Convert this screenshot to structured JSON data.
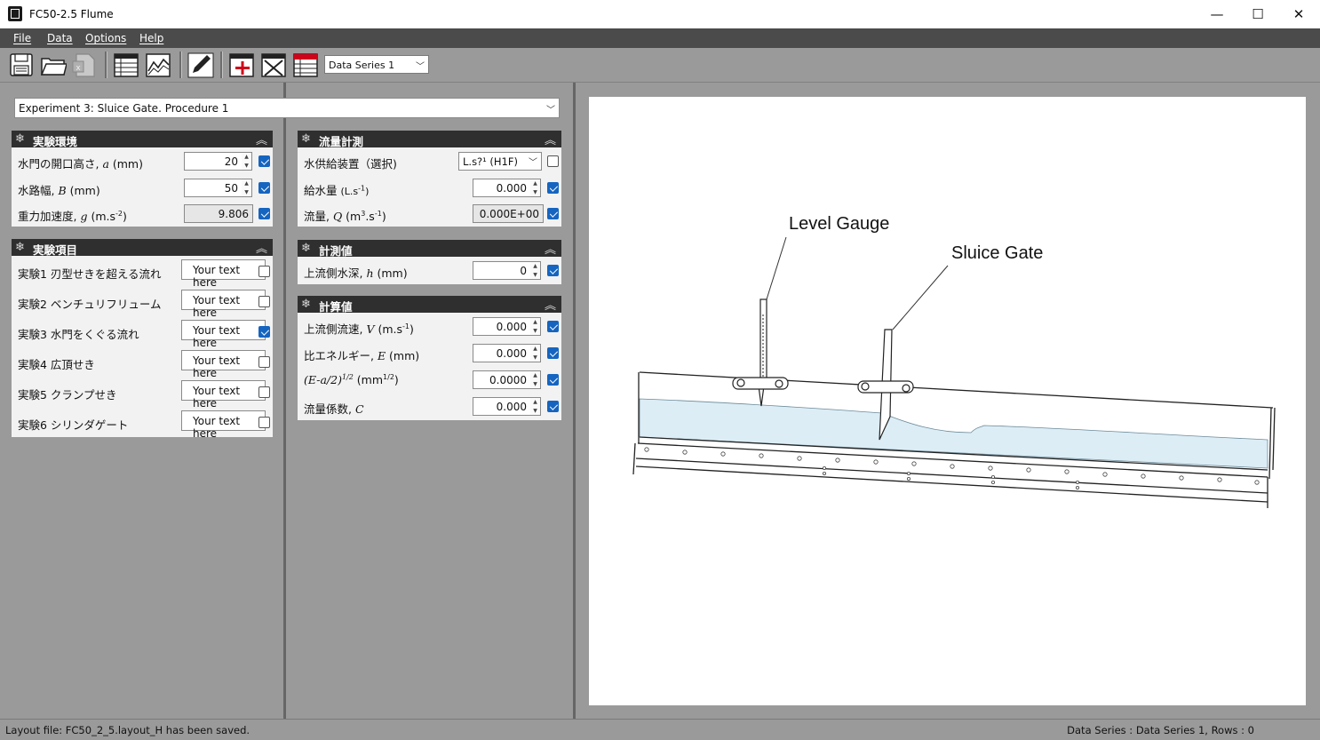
{
  "window": {
    "title": "FC50-2.5 Flume",
    "minimize": "—",
    "maximize": "☐",
    "close": "✕"
  },
  "menu": [
    "File",
    "Data",
    "Options",
    "Help"
  ],
  "toolbar": {
    "series_selected": "Data Series 1"
  },
  "experiment_select": "Experiment 3: Sluice Gate. Procedure 1",
  "env_panel": {
    "title": "実験環境",
    "rows": [
      {
        "label": "水門の開口高さ, ",
        "sym": "a",
        "unit": " (mm)",
        "value": "20",
        "checked": true
      },
      {
        "label": "水路幅, ",
        "sym": "B",
        "unit": " (mm)",
        "value": "50",
        "checked": true
      },
      {
        "label": "重力加速度, ",
        "sym": "g",
        "unit": " (m.s-2)",
        "value": "9.806",
        "checked": true
      }
    ]
  },
  "exp_panel": {
    "title": "実験項目",
    "placeholder": "Your text here",
    "rows": [
      {
        "label": "実験1 刃型せきを超える流れ",
        "checked": false
      },
      {
        "label": "実験2 ベンチュリフリューム",
        "checked": false
      },
      {
        "label": "実験3 水門をくぐる流れ",
        "checked": true
      },
      {
        "label": "実験4 広頂せき",
        "checked": false
      },
      {
        "label": "実験5 クランプせき",
        "checked": false
      },
      {
        "label": "実験6 シリンダゲート",
        "checked": false
      }
    ]
  },
  "flow_panel": {
    "title": "流量計測",
    "rows": [
      {
        "label": "水供給装置（選択)",
        "value": "L.s?¹ (H1F)",
        "checked": false
      },
      {
        "label": "給水量 ",
        "unit": "(L.s-1)",
        "value": "0.000",
        "checked": true
      },
      {
        "label": "流量, ",
        "sym": "Q",
        "unit": " (m3.s-1)",
        "value": "0.000E+00",
        "checked": true
      }
    ]
  },
  "measure_panel": {
    "title": "計測値",
    "rows": [
      {
        "label": "上流側水深, ",
        "sym": "h",
        "unit": " (mm)",
        "value": "0",
        "checked": true
      }
    ]
  },
  "calc_panel": {
    "title": "計算値",
    "rows": [
      {
        "label": "上流側流速, ",
        "sym": "V",
        "unit": " (m.s-1)",
        "value": "0.000",
        "checked": true
      },
      {
        "label": "比エネルギー, ",
        "sym": "E",
        "unit": " (mm)",
        "value": "0.000",
        "checked": true
      },
      {
        "label": "",
        "sym": "(E-a/2)1/2",
        "unit": " (mm1/2)",
        "value": "0.0000",
        "checked": true
      },
      {
        "label": "流量係数, ",
        "sym": "C",
        "unit": "",
        "value": "0.000",
        "checked": true
      }
    ]
  },
  "diagram": {
    "label_gauge": "Level Gauge",
    "label_gate": "Sluice Gate",
    "water_color": "#dcedf6"
  },
  "status": {
    "left": "Layout file: FC50_2_5.layout_H has been saved.",
    "right": "Data Series : Data Series 1,  Rows : 0"
  }
}
